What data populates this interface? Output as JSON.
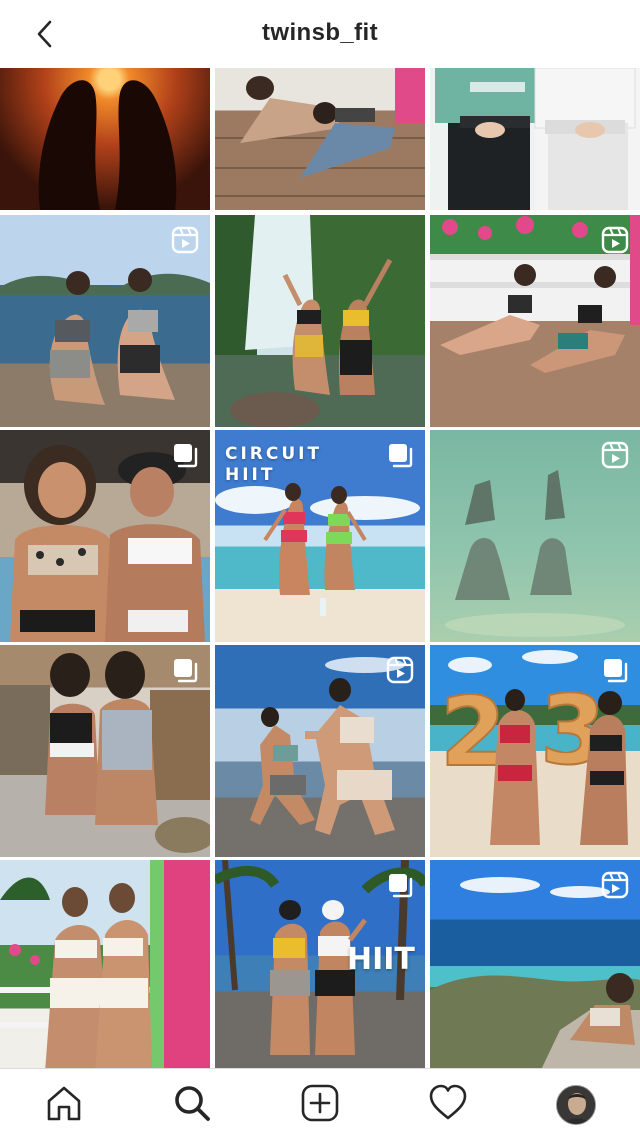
{
  "header": {
    "title": "twinsb_fit",
    "back_icon": "chevron-left-icon"
  },
  "grid": {
    "tiles": [
      {
        "name": "sunset-silhouette-post",
        "badge": "none"
      },
      {
        "name": "pushup-deck-post",
        "badge": "none"
      },
      {
        "name": "shark-gym-outfit-post",
        "badge": "none"
      },
      {
        "name": "seaside-lunge-post",
        "badge": "reel-icon"
      },
      {
        "name": "waterfall-post",
        "badge": "none"
      },
      {
        "name": "deck-abs-post",
        "badge": "reel-icon"
      },
      {
        "name": "beach-bikini-selfie-post",
        "badge": "carousel-icon"
      },
      {
        "name": "circuit-hiit-post",
        "badge": "carousel-icon",
        "overlay": "CIRCUIT\nHIIT"
      },
      {
        "name": "underwater-squat-post",
        "badge": "reel-icon"
      },
      {
        "name": "terrace-sitting-post",
        "badge": "carousel-icon"
      },
      {
        "name": "squat-rocks-post",
        "badge": "reel-icon"
      },
      {
        "name": "balloons-23-post",
        "badge": "carousel-icon"
      },
      {
        "name": "pink-door-post",
        "badge": "none"
      },
      {
        "name": "hiit-palms-post",
        "badge": "carousel-icon",
        "overlay": "HIIT"
      },
      {
        "name": "cliff-view-post",
        "badge": "reel-icon"
      }
    ]
  },
  "tabbar": {
    "items": [
      "home-icon",
      "search-icon",
      "new-post-icon",
      "activity-heart-icon",
      "profile-avatar"
    ]
  },
  "colors": {
    "text": "#262626",
    "divider": "#dbdbdb"
  }
}
